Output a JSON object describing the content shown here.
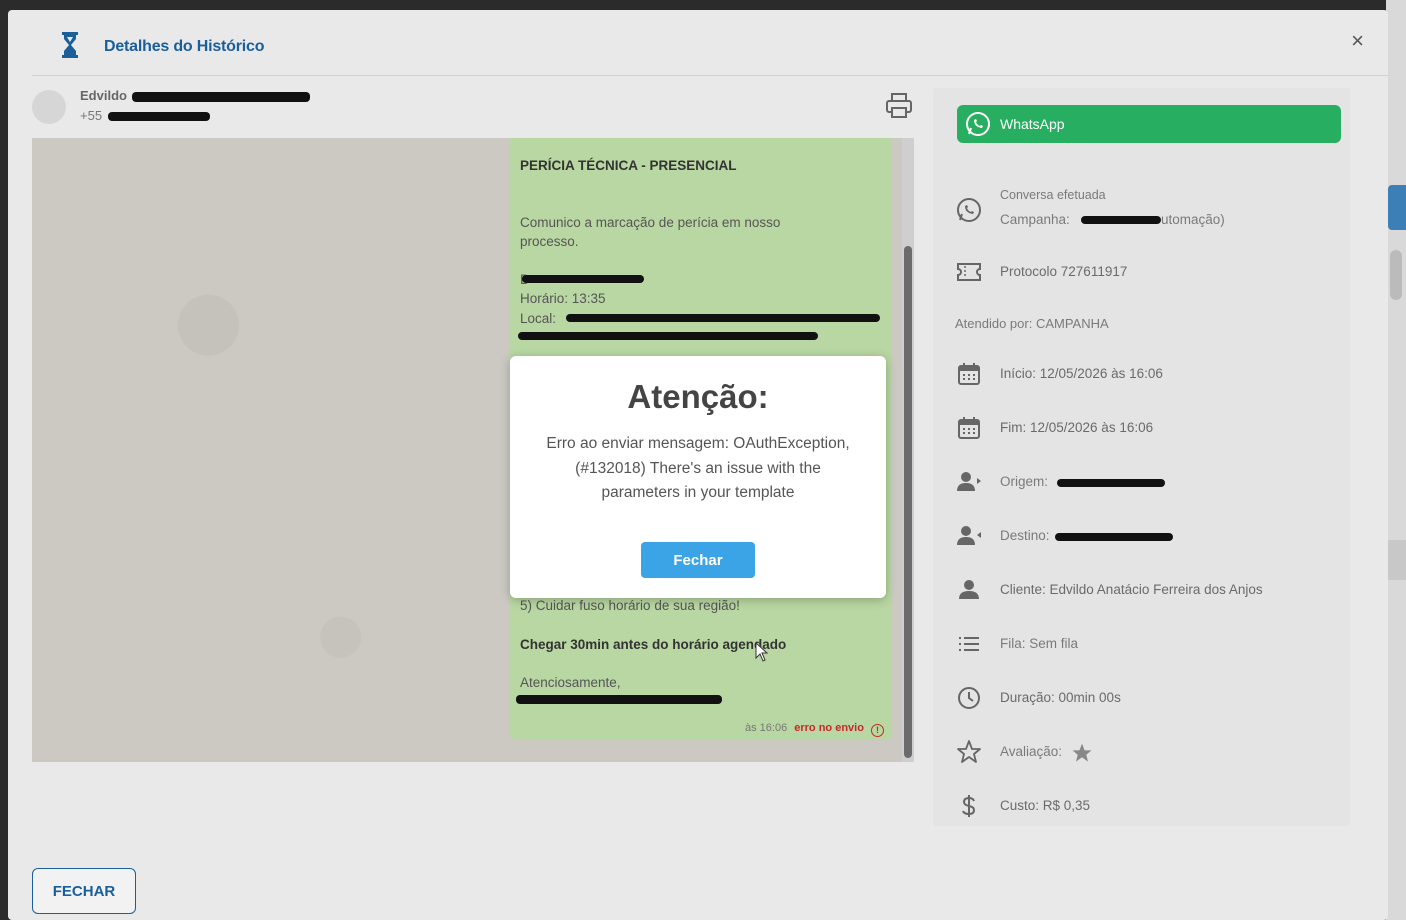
{
  "modal": {
    "title": "Detalhes do Histórico",
    "close_label": "×",
    "footer_button": "FECHAR"
  },
  "contact": {
    "name": "Edvildo",
    "phone": "+55"
  },
  "message": {
    "title": "PERÍCIA TÉCNICA - PRESENCIAL",
    "intro_line1": "Comunico a marcação de perícia em nosso",
    "intro_line2": "processo.",
    "date_label": "D",
    "time": "Horário: 13:35",
    "location_label": "Local:",
    "item5": "5) Cuidar fuso horário de sua região!",
    "arrive": "Chegar 30min antes do horário agendado",
    "closing": "Atenciosamente,",
    "time_sent": "às 16:06",
    "error_label": "erro no envio",
    "error_icon": "!"
  },
  "alert": {
    "title": "Atenção:",
    "message": "Erro ao enviar mensagem: OAuthException, (#132018) There's an issue with the parameters in your template",
    "button": "Fechar"
  },
  "panel": {
    "channel_button": "WhatsApp",
    "status": "Conversa efetuada",
    "campaign_label": "Campanha:",
    "campaign_suffix": "utomação)",
    "protocol": "Protocolo 727611917",
    "attended_by": "Atendido por: CAMPANHA",
    "start": "Início: 12/05/2026 às 16:06",
    "end": "Fim: 12/05/2026 às 16:06",
    "origin": "Origem:",
    "destination": "Destino:",
    "client": "Cliente: Edvildo Anatácio Ferreira dos Anjos",
    "queue": "Fila: Sem fila",
    "duration": "Duração: 00min 00s",
    "rating": "Avaliação:",
    "cost": "Custo: R$ 0,35"
  },
  "colors": {
    "brand_blue": "#1a5e9a",
    "whatsapp_green": "#27ae60",
    "bubble_green": "#b9d7a2",
    "alert_button": "#3aa4e6",
    "error_red": "#c62828"
  },
  "icons": [
    "hourglass-icon",
    "close-icon",
    "printer-icon",
    "whatsapp-icon",
    "ticket-icon",
    "calendar-icon",
    "user-outgoing-icon",
    "user-incoming-icon",
    "user-icon",
    "list-icon",
    "clock-icon",
    "star-icon",
    "dollar-icon"
  ]
}
